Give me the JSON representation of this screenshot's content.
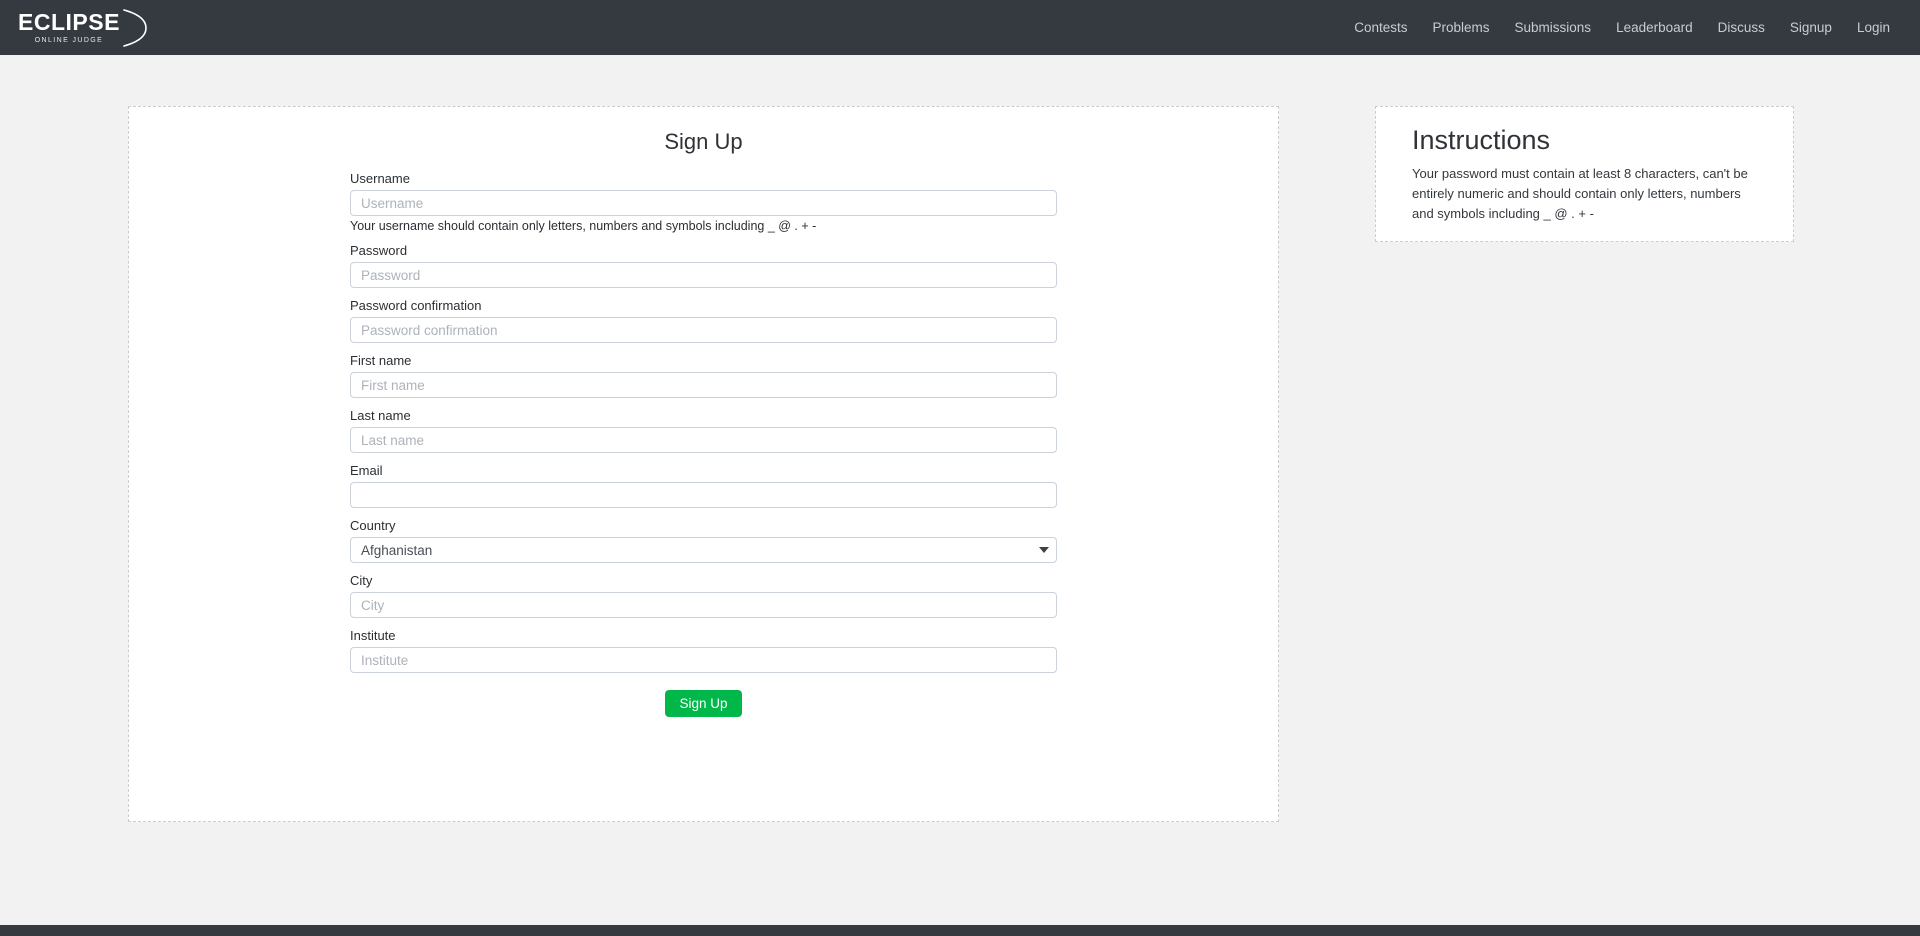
{
  "navbar": {
    "brand": {
      "main": "ECLIPSE",
      "sub": "ONLINE JUDGE",
      "arc_icon": "crescent-arc-icon"
    },
    "links": [
      {
        "label": "Contests"
      },
      {
        "label": "Problems"
      },
      {
        "label": "Submissions"
      },
      {
        "label": "Leaderboard"
      },
      {
        "label": "Discuss"
      },
      {
        "label": "Signup"
      },
      {
        "label": "Login"
      }
    ],
    "background_color": "#343a40",
    "link_color": "#c9ccd1"
  },
  "form": {
    "title": "Sign Up",
    "fields": {
      "username": {
        "label": "Username",
        "placeholder": "Username",
        "value": "",
        "help": "Your username should contain only letters, numbers and symbols including _ @ . + -"
      },
      "password": {
        "label": "Password",
        "placeholder": "Password",
        "value": ""
      },
      "password_confirmation": {
        "label": "Password confirmation",
        "placeholder": "Password confirmation",
        "value": ""
      },
      "first_name": {
        "label": "First name",
        "placeholder": "First name",
        "value": ""
      },
      "last_name": {
        "label": "Last name",
        "placeholder": "Last name",
        "value": ""
      },
      "email": {
        "label": "Email",
        "placeholder": "",
        "value": ""
      },
      "country": {
        "label": "Country",
        "selected": "Afghanistan",
        "arrow_icon": "chevron-down-icon"
      },
      "city": {
        "label": "City",
        "placeholder": "City",
        "value": ""
      },
      "institute": {
        "label": "Institute",
        "placeholder": "Institute",
        "value": ""
      }
    },
    "submit_label": "Sign Up",
    "submit_color": "#00b84a"
  },
  "instructions": {
    "title": "Instructions",
    "body": "Your password must contain at least 8 characters, can't be entirely numeric and should contain only letters, numbers and symbols including _ @ . + -"
  },
  "footer": {
    "background_color": "#343a40"
  }
}
